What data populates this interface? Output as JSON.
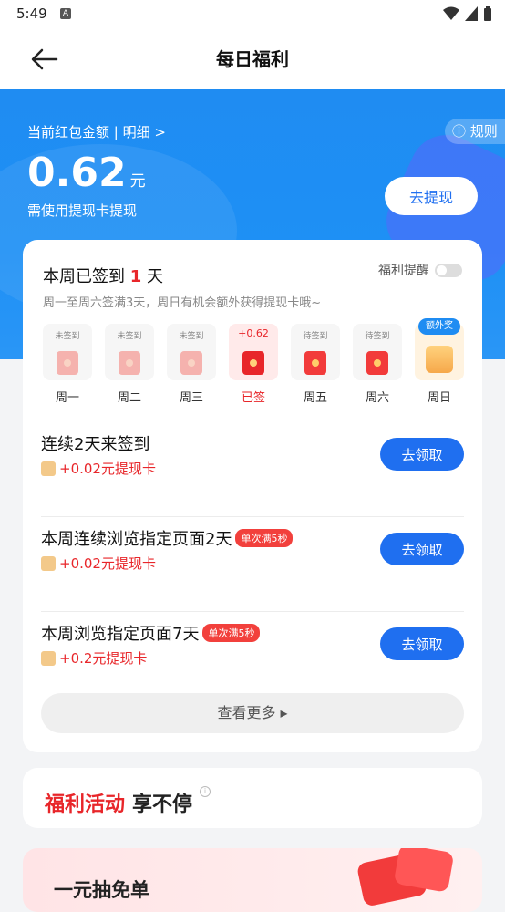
{
  "status_bar": {
    "time": "5:49",
    "app_icon": "A"
  },
  "nav": {
    "title": "每日福利",
    "back_icon": "arrow-left-icon"
  },
  "balance": {
    "label": "当前红包金额 | 明细 >",
    "amount": "0.62",
    "unit": "元",
    "hint": "需使用提现卡提现",
    "withdraw_button": "去提现",
    "rules_button": "ⓘ 规则"
  },
  "checkin": {
    "title_prefix": "本周已签到 ",
    "days_count": "1",
    "title_suffix": " 天",
    "reminder_label": "福利提醒",
    "subtitle": "周一至周六签满3天，周日有机会额外获得提现卡哦~",
    "days": [
      {
        "status": "未签到",
        "label": "周一"
      },
      {
        "status": "未签到",
        "label": "周二"
      },
      {
        "status": "未签到",
        "label": "周三"
      },
      {
        "status": "+0.62",
        "label": "已签"
      },
      {
        "status": "待签到",
        "label": "周五"
      },
      {
        "status": "待签到",
        "label": "周六"
      },
      {
        "status": "额外奖",
        "label": "周日"
      }
    ]
  },
  "tasks": [
    {
      "name": "连续2天来签到",
      "badge": "",
      "reward": "+0.02元提现卡",
      "button": "去领取"
    },
    {
      "name": "本周连续浏览指定页面2天",
      "badge": "单次满5秒",
      "reward": "+0.02元提现卡",
      "button": "去领取"
    },
    {
      "name": "本周浏览指定页面7天",
      "badge": "单次满5秒",
      "reward": "+0.2元提现卡",
      "button": "去领取"
    }
  ],
  "more_button": "查看更多 ▸",
  "activity": {
    "highlight": "福利活动",
    "rest": "享不停"
  },
  "promo": {
    "title": "一元抽免单"
  }
}
